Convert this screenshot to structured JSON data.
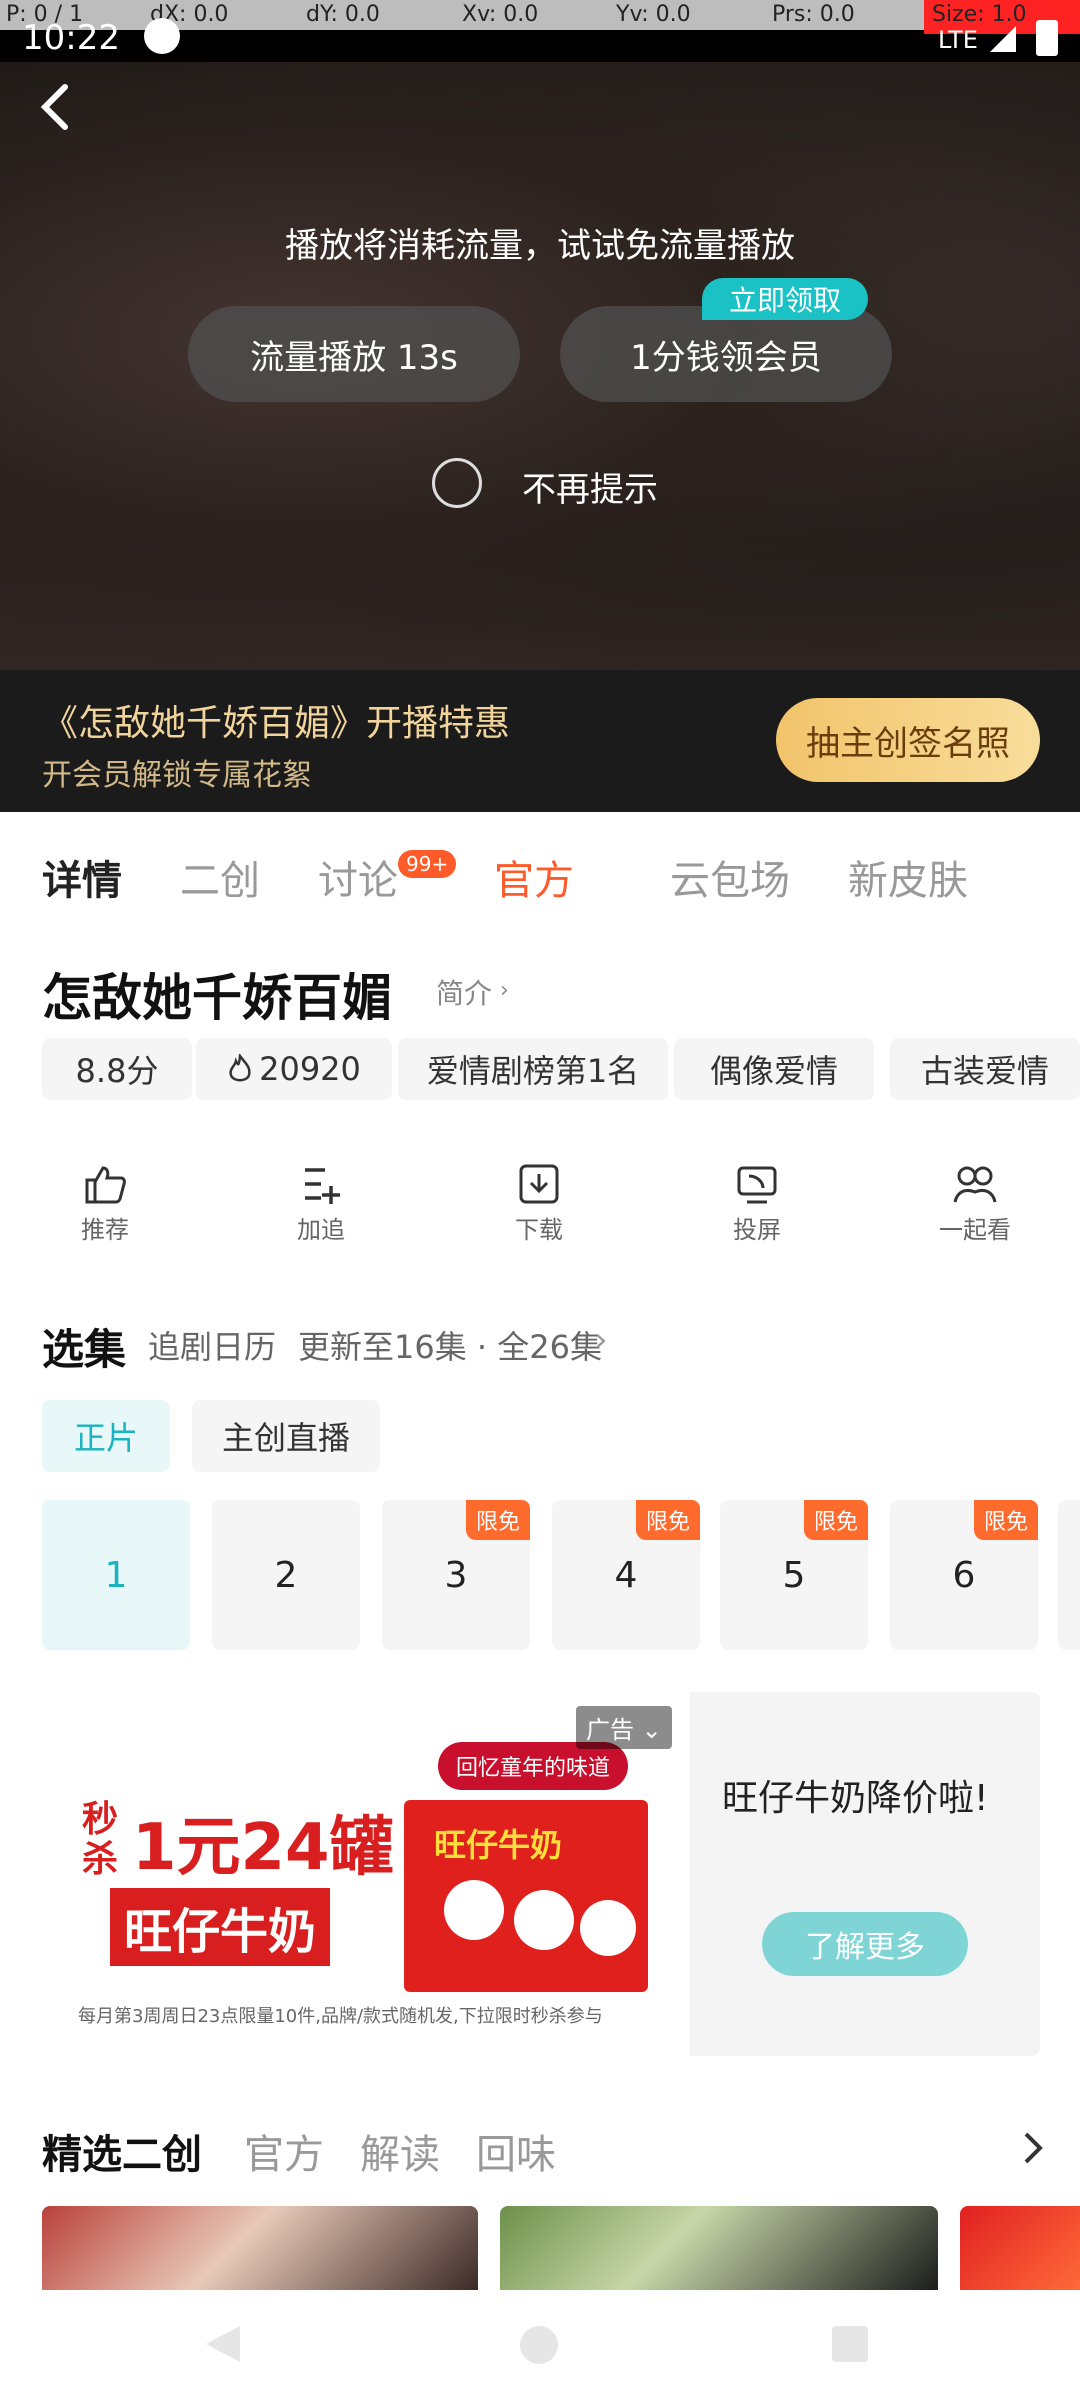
{
  "debug": {
    "p": "P: 0 / 1",
    "dx": "dX: 0.0",
    "dy": "dY: 0.0",
    "xv": "Xv: 0.0",
    "yv": "Yv: 0.0",
    "prs": "Prs: 0.0",
    "size": "Size: 1.0"
  },
  "status": {
    "time": "10:22",
    "network": "LTE"
  },
  "player": {
    "notice": "播放将消耗流量，试试免流量播放",
    "play_with_data": "流量播放 13s",
    "member_offer": "1分钱领会员",
    "claim_badge": "立即领取",
    "dont_remind": "不再提示"
  },
  "promo": {
    "title": "《怎敌她千娇百媚》开播特惠",
    "subtitle": "开会员解锁专属花絮",
    "button": "抽主创签名照"
  },
  "tabs": [
    {
      "label": "详情"
    },
    {
      "label": "二创"
    },
    {
      "label": "讨论",
      "badge": "99+"
    },
    {
      "label": "官方"
    },
    {
      "label": "云包场"
    },
    {
      "label": "新皮肤"
    }
  ],
  "show": {
    "title": "怎敌她千娇百媚",
    "intro": "简介",
    "tags": [
      "8.8分",
      "20920",
      "爱情剧榜第1名",
      "偶像爱情",
      "古装爱情"
    ]
  },
  "actions": [
    {
      "label": "推荐",
      "icon": "thumbs-up-icon"
    },
    {
      "label": "加追",
      "icon": "add-follow-icon"
    },
    {
      "label": "下载",
      "icon": "download-icon"
    },
    {
      "label": "投屏",
      "icon": "cast-icon"
    },
    {
      "label": "一起看",
      "icon": "watch-together-icon"
    }
  ],
  "episodes_header": {
    "title": "选集",
    "calendar": "追剧日历",
    "update": "更新至16集 · 全26集"
  },
  "content_tabs": [
    "正片",
    "主创直播"
  ],
  "episodes": [
    {
      "num": "1",
      "badge": ""
    },
    {
      "num": "2",
      "badge": ""
    },
    {
      "num": "3",
      "badge": "限免"
    },
    {
      "num": "4",
      "badge": "限免"
    },
    {
      "num": "5",
      "badge": "限免"
    },
    {
      "num": "6",
      "badge": "限免"
    }
  ],
  "ad": {
    "badge": "广告",
    "img_line1": "秒杀",
    "img_big": "1元24罐",
    "img_product": "旺仔牛奶",
    "img_slogan": "回忆童年的味道",
    "img_footer": "每月第3周周日23点限量10件,品牌/款式随机发,下拉限时秒杀参与",
    "headline": "旺仔牛奶降价啦!",
    "cta": "了解更多"
  },
  "bottom_tabs": [
    "精选二创",
    "官方",
    "解读",
    "回味"
  ]
}
